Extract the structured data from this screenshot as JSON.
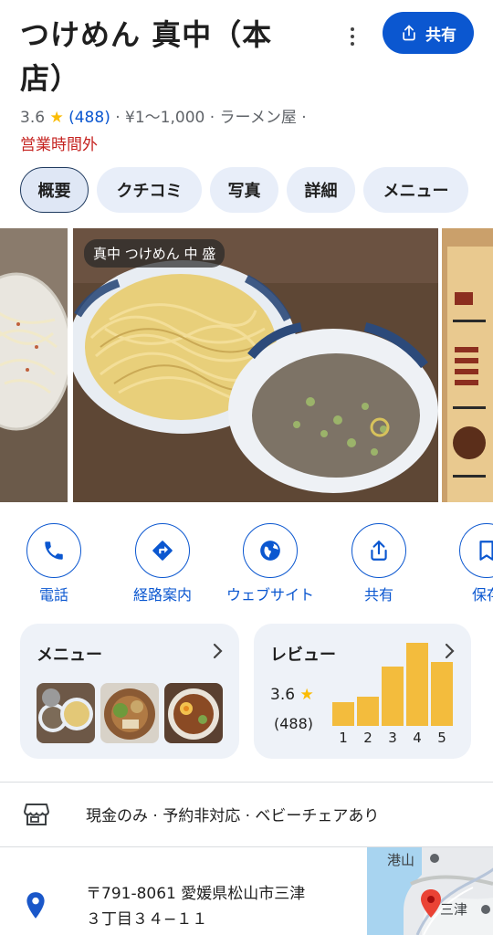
{
  "place": {
    "title": "つけめん 真中（本店）",
    "rating": "3.6",
    "star": "★",
    "review_count": "(488)",
    "meta_rest": "· ¥1〜1,000 · ラーメン屋 ·",
    "status": "営業時間外"
  },
  "header": {
    "share_label": "共有",
    "more_icon": "more-vert-icon",
    "share_icon": "share-icon"
  },
  "tabs": [
    {
      "label": "概要",
      "active": true
    },
    {
      "label": "クチコミ",
      "active": false
    },
    {
      "label": "写真",
      "active": false
    },
    {
      "label": "詳細",
      "active": false
    },
    {
      "label": "メニュー",
      "active": false
    }
  ],
  "photos": {
    "caption": "真中 つけめん 中 盛"
  },
  "actions": [
    {
      "label": "電話",
      "icon": "phone-icon"
    },
    {
      "label": "経路案内",
      "icon": "directions-icon"
    },
    {
      "label": "ウェブサイト",
      "icon": "globe-icon"
    },
    {
      "label": "共有",
      "icon": "share-icon"
    },
    {
      "label": "保存",
      "icon": "bookmark-icon"
    }
  ],
  "menu_card": {
    "title": "メニュー"
  },
  "review_card": {
    "title": "レビュー",
    "score": "3.6",
    "star": "★",
    "count": "(488)",
    "bars": [
      {
        "label": "1",
        "share": 0.19
      },
      {
        "label": "2",
        "share": 0.23
      },
      {
        "label": "3",
        "share": 0.47
      },
      {
        "label": "4",
        "share": 0.66
      },
      {
        "label": "5",
        "share": 0.51
      }
    ]
  },
  "amenities": {
    "text": "現金のみ · 予約非対応 · ベビーチェアあり",
    "icon": "storefront-icon"
  },
  "address": {
    "line1": "〒791-8061 愛媛県松山市三津",
    "line2": "３丁目３４−１１",
    "icon": "location-pin-icon"
  },
  "map": {
    "label_top": "港山",
    "label_bottom": "三津"
  },
  "colors": {
    "accent": "#0b57d0",
    "closed": "#c5221f",
    "star": "#fbbc04",
    "bar": "#f3bc3d"
  }
}
